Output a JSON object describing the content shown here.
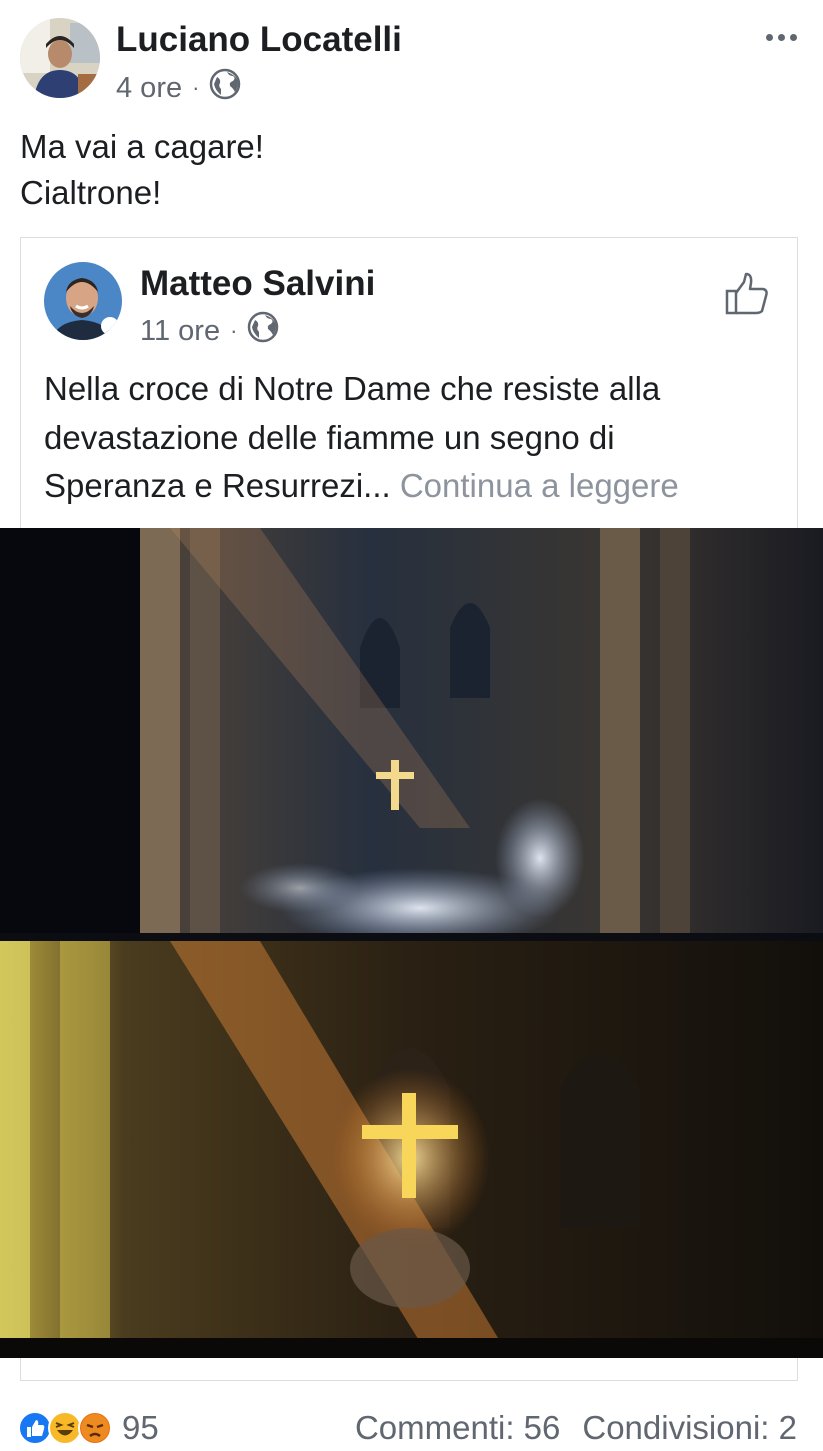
{
  "post": {
    "author": "Luciano Locatelli",
    "time": "4 ore",
    "separator": "·",
    "privacy_icon": "globe-icon",
    "more_icon": "more-options-icon",
    "text_line1": "Ma vai a cagare!",
    "text_line2": "Cialtrone!"
  },
  "shared": {
    "author": "Matteo Salvini",
    "time": "11 ore",
    "separator": "·",
    "privacy_icon": "globe-icon",
    "like_icon": "thumbs-up-icon",
    "text_line1": "Nella croce di Notre Dame che resiste alla",
    "text_line2": "devastazione delle fiamme un segno di",
    "text_line3": "Speranza e Resurrezi...",
    "continue_label": "Continua a leggere"
  },
  "footer": {
    "reaction_icons": [
      "like-reaction-icon",
      "haha-reaction-icon",
      "angry-reaction-icon"
    ],
    "reaction_count": "95",
    "comments": "Commenti: 56",
    "shares": "Condivisioni: 2"
  },
  "colors": {
    "primary_text": "#1c1e21",
    "secondary_text": "#606770",
    "link_gray": "#8d949e",
    "like_blue": "#1877f2",
    "haha_yellow": "#f7b928",
    "angry_red": "#e9710f"
  }
}
